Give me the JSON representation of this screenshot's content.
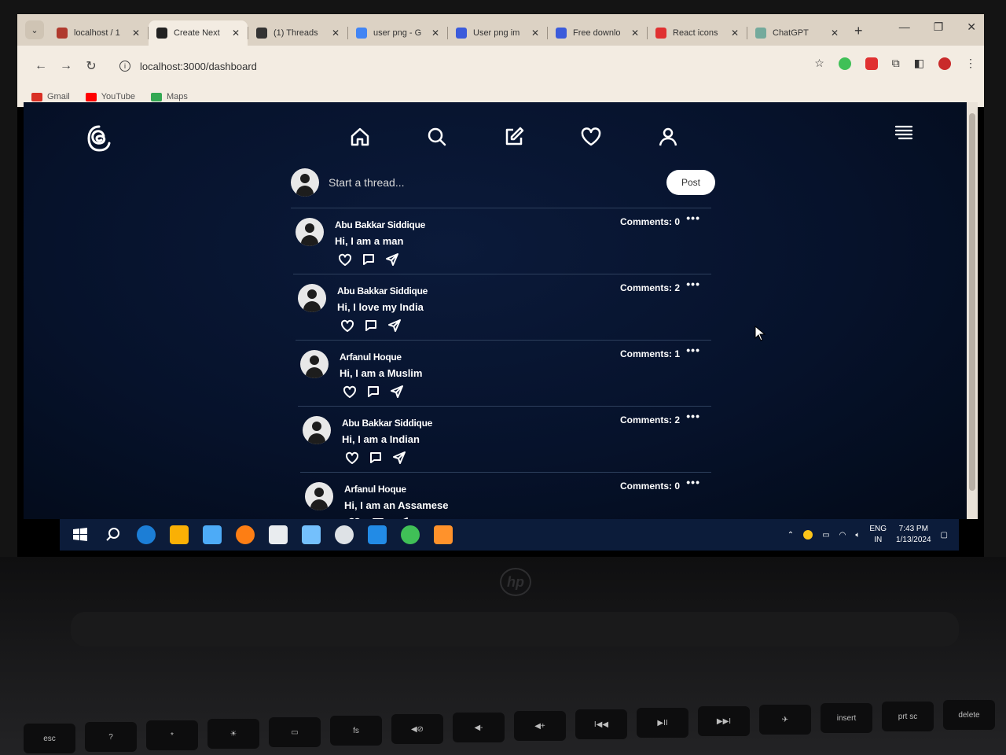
{
  "browser": {
    "tabs": [
      {
        "title": "localhost / 1",
        "favicon_color": "#b03a2e",
        "active": false
      },
      {
        "title": "Create Next",
        "favicon_color": "#222222",
        "active": true
      },
      {
        "title": "(1) Threads",
        "favicon_color": "#333333",
        "active": false
      },
      {
        "title": "user png - G",
        "favicon_color": "#4285f4",
        "active": false
      },
      {
        "title": "User png im",
        "favicon_color": "#3b5bdb",
        "active": false
      },
      {
        "title": "Free downlo",
        "favicon_color": "#3b5bdb",
        "active": false
      },
      {
        "title": "React icons",
        "favicon_color": "#e03131",
        "active": false
      },
      {
        "title": "ChatGPT",
        "favicon_color": "#74aa9c",
        "active": false
      }
    ],
    "address": "localhost:3000/dashboard",
    "bookmarks": [
      {
        "label": "Gmail",
        "color": "#d93025"
      },
      {
        "label": "YouTube",
        "color": "#ff0000"
      },
      {
        "label": "Maps",
        "color": "#34a853"
      }
    ]
  },
  "app": {
    "composer": {
      "placeholder": "Start a thread...",
      "post_label": "Post"
    },
    "posts": [
      {
        "author": "Abu Bakkar Siddique",
        "text": "Hi, I am a man",
        "comments": "Comments: 0",
        "more": "•••"
      },
      {
        "author": "Abu Bakkar Siddique",
        "text": "Hi, I love my India",
        "comments": "Comments: 2",
        "more": "•••"
      },
      {
        "author": "Arfanul Hoque",
        "text": "Hi, I am a Muslim",
        "comments": "Comments: 1",
        "more": "•••"
      },
      {
        "author": "Abu Bakkar Siddique",
        "text": "Hi, I am a Indian",
        "comments": "Comments: 2",
        "more": "•••"
      },
      {
        "author": "Arfanul Hoque",
        "text": "Hi, I am an Assamese",
        "comments": "Comments: 0",
        "more": "•••"
      }
    ],
    "nav_icons": [
      "home-icon",
      "search-icon",
      "compose-icon",
      "heart-icon",
      "profile-icon"
    ]
  },
  "taskbar": {
    "lang_top": "ENG",
    "lang_bottom": "IN",
    "time": "7:43 PM",
    "date": "1/13/2024"
  },
  "laptop": {
    "brand": "hp",
    "keys": [
      "esc",
      "?",
      "*",
      "☀",
      "▭",
      "fs",
      "◀⊘",
      "◀-",
      "◀+",
      "I◀◀",
      "▶II",
      "▶▶I",
      "✈",
      "insert",
      "prt sc",
      "delete"
    ]
  }
}
